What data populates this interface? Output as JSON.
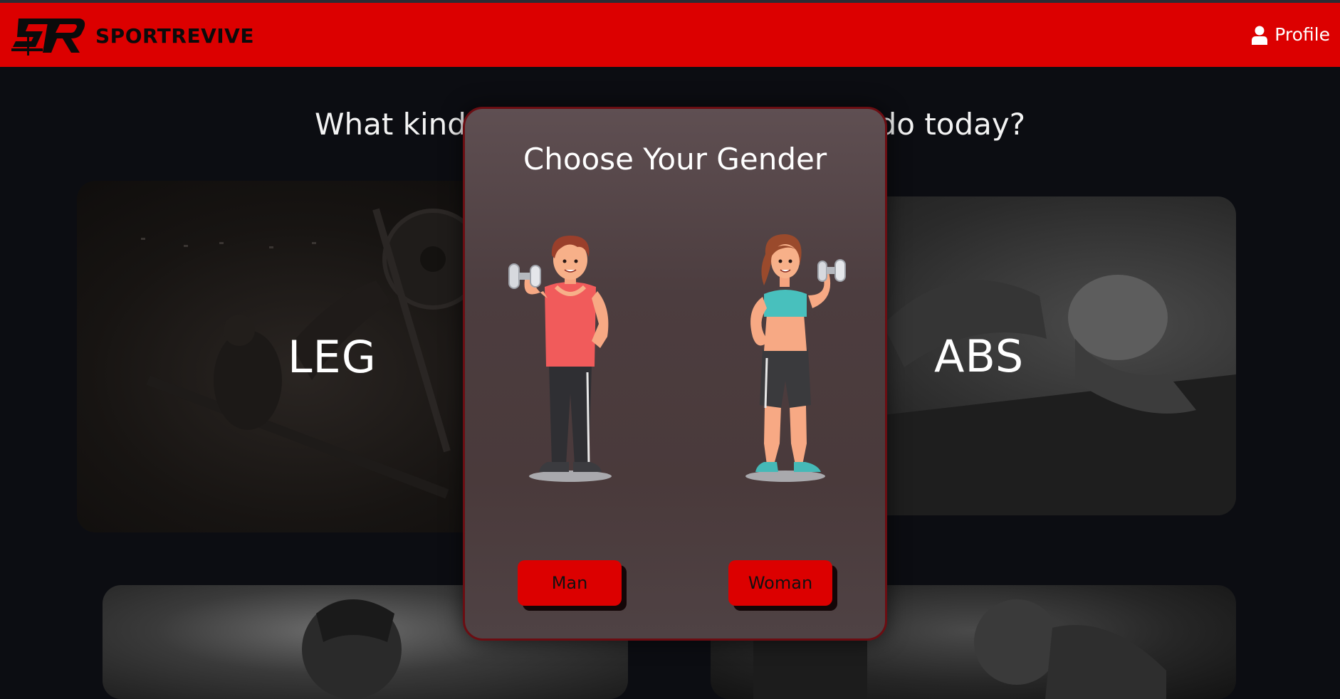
{
  "header": {
    "logo_text": "SR",
    "brand_name": "SPORTREVIVE",
    "profile_label": "Profile",
    "profile_icon": "user-icon"
  },
  "main": {
    "question": "What kind of workout do you want to do today?",
    "categories": [
      {
        "label": "LEG"
      },
      {
        "label": "ABS"
      }
    ]
  },
  "modal": {
    "title": "Choose Your Gender",
    "options": [
      {
        "label": "Man",
        "illustration": "man-dumbbell-illustration"
      },
      {
        "label": "Woman",
        "illustration": "woman-dumbbell-illustration"
      }
    ]
  },
  "colors": {
    "brand_red": "#dc0000",
    "page_background": "#0c0d12",
    "modal_background": "#4c3d3f",
    "modal_border": "#6b0d12"
  }
}
